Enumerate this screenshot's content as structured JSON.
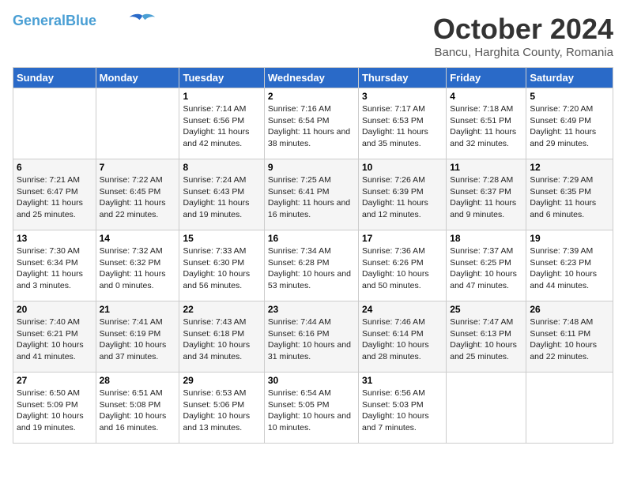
{
  "header": {
    "logo_line1": "General",
    "logo_line2": "Blue",
    "month": "October 2024",
    "location": "Bancu, Harghita County, Romania"
  },
  "weekdays": [
    "Sunday",
    "Monday",
    "Tuesday",
    "Wednesday",
    "Thursday",
    "Friday",
    "Saturday"
  ],
  "weeks": [
    [
      {
        "day": "",
        "info": ""
      },
      {
        "day": "",
        "info": ""
      },
      {
        "day": "1",
        "info": "Sunrise: 7:14 AM\nSunset: 6:56 PM\nDaylight: 11 hours and 42 minutes."
      },
      {
        "day": "2",
        "info": "Sunrise: 7:16 AM\nSunset: 6:54 PM\nDaylight: 11 hours and 38 minutes."
      },
      {
        "day": "3",
        "info": "Sunrise: 7:17 AM\nSunset: 6:53 PM\nDaylight: 11 hours and 35 minutes."
      },
      {
        "day": "4",
        "info": "Sunrise: 7:18 AM\nSunset: 6:51 PM\nDaylight: 11 hours and 32 minutes."
      },
      {
        "day": "5",
        "info": "Sunrise: 7:20 AM\nSunset: 6:49 PM\nDaylight: 11 hours and 29 minutes."
      }
    ],
    [
      {
        "day": "6",
        "info": "Sunrise: 7:21 AM\nSunset: 6:47 PM\nDaylight: 11 hours and 25 minutes."
      },
      {
        "day": "7",
        "info": "Sunrise: 7:22 AM\nSunset: 6:45 PM\nDaylight: 11 hours and 22 minutes."
      },
      {
        "day": "8",
        "info": "Sunrise: 7:24 AM\nSunset: 6:43 PM\nDaylight: 11 hours and 19 minutes."
      },
      {
        "day": "9",
        "info": "Sunrise: 7:25 AM\nSunset: 6:41 PM\nDaylight: 11 hours and 16 minutes."
      },
      {
        "day": "10",
        "info": "Sunrise: 7:26 AM\nSunset: 6:39 PM\nDaylight: 11 hours and 12 minutes."
      },
      {
        "day": "11",
        "info": "Sunrise: 7:28 AM\nSunset: 6:37 PM\nDaylight: 11 hours and 9 minutes."
      },
      {
        "day": "12",
        "info": "Sunrise: 7:29 AM\nSunset: 6:35 PM\nDaylight: 11 hours and 6 minutes."
      }
    ],
    [
      {
        "day": "13",
        "info": "Sunrise: 7:30 AM\nSunset: 6:34 PM\nDaylight: 11 hours and 3 minutes."
      },
      {
        "day": "14",
        "info": "Sunrise: 7:32 AM\nSunset: 6:32 PM\nDaylight: 11 hours and 0 minutes."
      },
      {
        "day": "15",
        "info": "Sunrise: 7:33 AM\nSunset: 6:30 PM\nDaylight: 10 hours and 56 minutes."
      },
      {
        "day": "16",
        "info": "Sunrise: 7:34 AM\nSunset: 6:28 PM\nDaylight: 10 hours and 53 minutes."
      },
      {
        "day": "17",
        "info": "Sunrise: 7:36 AM\nSunset: 6:26 PM\nDaylight: 10 hours and 50 minutes."
      },
      {
        "day": "18",
        "info": "Sunrise: 7:37 AM\nSunset: 6:25 PM\nDaylight: 10 hours and 47 minutes."
      },
      {
        "day": "19",
        "info": "Sunrise: 7:39 AM\nSunset: 6:23 PM\nDaylight: 10 hours and 44 minutes."
      }
    ],
    [
      {
        "day": "20",
        "info": "Sunrise: 7:40 AM\nSunset: 6:21 PM\nDaylight: 10 hours and 41 minutes."
      },
      {
        "day": "21",
        "info": "Sunrise: 7:41 AM\nSunset: 6:19 PM\nDaylight: 10 hours and 37 minutes."
      },
      {
        "day": "22",
        "info": "Sunrise: 7:43 AM\nSunset: 6:18 PM\nDaylight: 10 hours and 34 minutes."
      },
      {
        "day": "23",
        "info": "Sunrise: 7:44 AM\nSunset: 6:16 PM\nDaylight: 10 hours and 31 minutes."
      },
      {
        "day": "24",
        "info": "Sunrise: 7:46 AM\nSunset: 6:14 PM\nDaylight: 10 hours and 28 minutes."
      },
      {
        "day": "25",
        "info": "Sunrise: 7:47 AM\nSunset: 6:13 PM\nDaylight: 10 hours and 25 minutes."
      },
      {
        "day": "26",
        "info": "Sunrise: 7:48 AM\nSunset: 6:11 PM\nDaylight: 10 hours and 22 minutes."
      }
    ],
    [
      {
        "day": "27",
        "info": "Sunrise: 6:50 AM\nSunset: 5:09 PM\nDaylight: 10 hours and 19 minutes."
      },
      {
        "day": "28",
        "info": "Sunrise: 6:51 AM\nSunset: 5:08 PM\nDaylight: 10 hours and 16 minutes."
      },
      {
        "day": "29",
        "info": "Sunrise: 6:53 AM\nSunset: 5:06 PM\nDaylight: 10 hours and 13 minutes."
      },
      {
        "day": "30",
        "info": "Sunrise: 6:54 AM\nSunset: 5:05 PM\nDaylight: 10 hours and 10 minutes."
      },
      {
        "day": "31",
        "info": "Sunrise: 6:56 AM\nSunset: 5:03 PM\nDaylight: 10 hours and 7 minutes."
      },
      {
        "day": "",
        "info": ""
      },
      {
        "day": "",
        "info": ""
      }
    ]
  ]
}
